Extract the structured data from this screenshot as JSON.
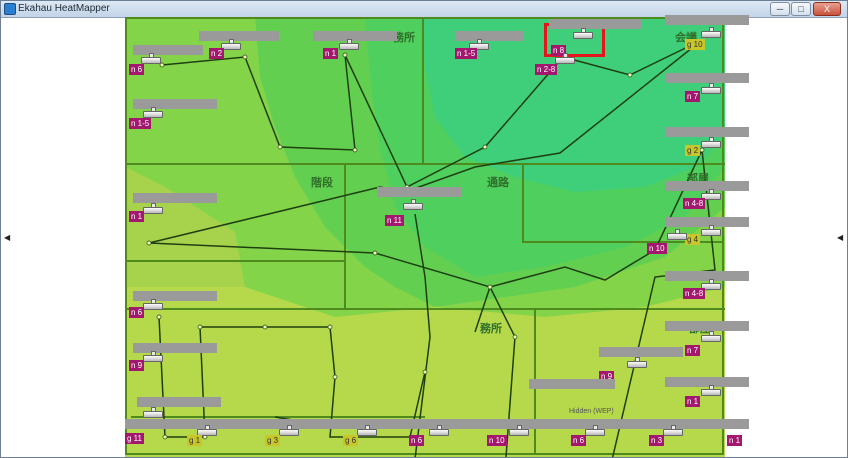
{
  "window": {
    "title": "Ekahau HeatMapper",
    "buttons": [
      "─",
      "□",
      "X"
    ]
  },
  "side_arrows": {
    "left": "◀",
    "right": "◀"
  },
  "rooms": [
    {
      "id": "office",
      "label": "務所"
    },
    {
      "id": "meeting",
      "label": "会議"
    },
    {
      "id": "stairs",
      "label": "階段"
    },
    {
      "id": "corridor",
      "label": "通路"
    },
    {
      "id": "room",
      "label": "部屋"
    },
    {
      "id": "office2",
      "label": "務所"
    },
    {
      "id": "room2",
      "label": "部屋"
    }
  ],
  "access_points": [
    {
      "id": "ap1",
      "tag": "n 6",
      "band": "n"
    },
    {
      "id": "ap2",
      "tag": "n 2",
      "band": "n"
    },
    {
      "id": "ap3",
      "tag": "n 1",
      "band": "n"
    },
    {
      "id": "ap4",
      "tag": "n 1-5",
      "band": "n"
    },
    {
      "id": "ap5",
      "tag": "n 8",
      "band": "n"
    },
    {
      "id": "ap6",
      "tag": "n 2-8",
      "band": "n"
    },
    {
      "id": "ap7",
      "tag": "g 10",
      "band": "g"
    },
    {
      "id": "ap8",
      "tag": "n 1-5",
      "band": "n"
    },
    {
      "id": "ap9",
      "tag": "n 7",
      "band": "n"
    },
    {
      "id": "ap10",
      "tag": "g 2",
      "band": "g"
    },
    {
      "id": "ap11",
      "tag": "n 1",
      "band": "n"
    },
    {
      "id": "ap12",
      "tag": "n 11",
      "band": "n"
    },
    {
      "id": "ap13",
      "tag": "n 4-8",
      "band": "n"
    },
    {
      "id": "ap14",
      "tag": "g 4",
      "band": "g"
    },
    {
      "id": "ap15",
      "tag": "n 10",
      "band": "n"
    },
    {
      "id": "ap16",
      "tag": "n 4-8",
      "band": "n"
    },
    {
      "id": "ap17",
      "tag": "n 6",
      "band": "n"
    },
    {
      "id": "ap18",
      "tag": "n 9",
      "band": "n"
    },
    {
      "id": "ap19",
      "tag": "n 7",
      "band": "n"
    },
    {
      "id": "ap20",
      "tag": "n 9",
      "band": "n"
    },
    {
      "id": "ap21",
      "tag": "n 1",
      "band": "n"
    },
    {
      "id": "ap22",
      "tag": "g 1",
      "band": "g"
    },
    {
      "id": "ap23",
      "tag": "g 3",
      "band": "g"
    },
    {
      "id": "ap24",
      "tag": "g 6",
      "band": "g"
    },
    {
      "id": "ap25",
      "tag": "n 6",
      "band": "n"
    },
    {
      "id": "ap26",
      "tag": "n 10",
      "band": "n"
    },
    {
      "id": "ap27",
      "tag": "g 11",
      "band": "g"
    },
    {
      "id": "ap28",
      "tag": "n 6",
      "band": "n"
    },
    {
      "id": "ap29",
      "tag": "n 3",
      "band": "n"
    },
    {
      "id": "ap30",
      "tag": "n 1",
      "band": "n"
    }
  ],
  "hidden_label": "Hidden (WEP)",
  "colors": {
    "strong": "#3fcf7a",
    "medium": "#4fd35a",
    "weak": "#84d44a",
    "weakest": "#b5d94b",
    "wall": "#4f8a1e",
    "selection": "#e3161b",
    "tag_n": "#a3176e",
    "tag_g": "#c9c62a"
  }
}
